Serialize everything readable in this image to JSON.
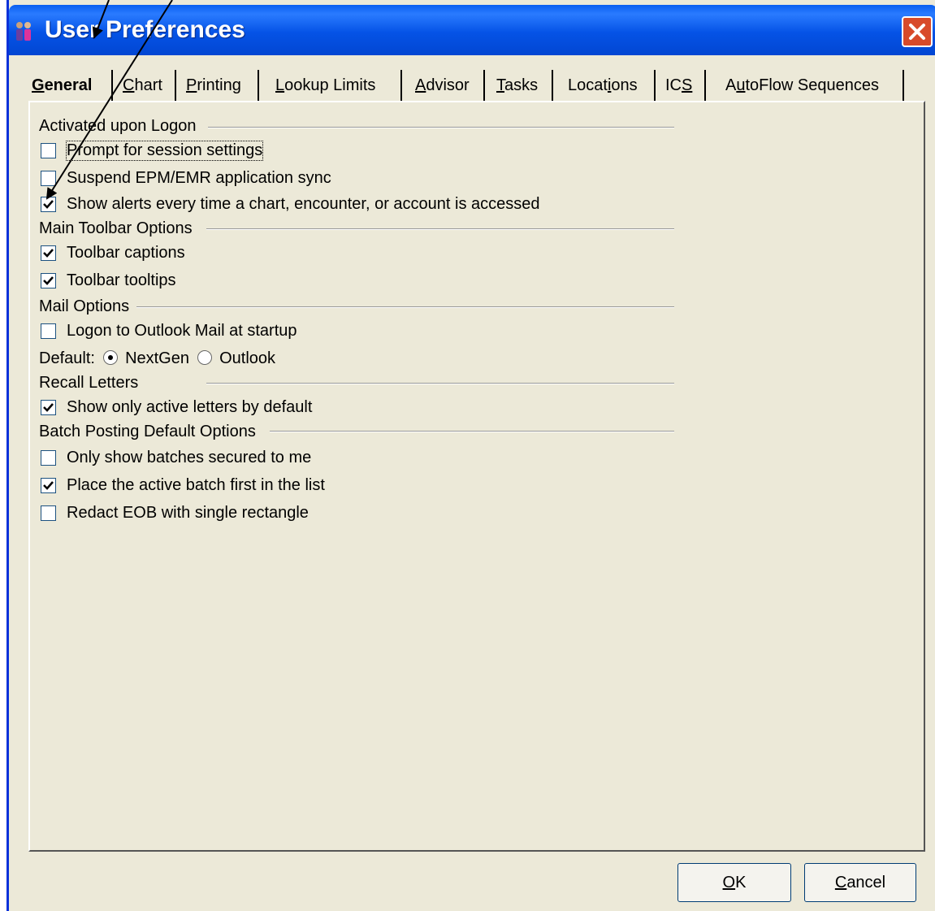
{
  "window": {
    "title": "User Preferences"
  },
  "tabs": [
    {
      "label": "General",
      "u": "G",
      "rest": "eneral",
      "pre": ""
    },
    {
      "label": "Chart",
      "pre": "",
      "u": "C",
      "rest": "hart"
    },
    {
      "label": "Printing",
      "pre": "",
      "u": "P",
      "rest": "rinting"
    },
    {
      "label": "Lookup Limits",
      "pre": "",
      "u": "L",
      "rest": "ookup Limits"
    },
    {
      "label": "Advisor",
      "pre": "",
      "u": "A",
      "rest": "dvisor"
    },
    {
      "label": "Tasks",
      "pre": "",
      "u": "T",
      "rest": "asks"
    },
    {
      "label": "Locations",
      "pre": "Locat",
      "u": "i",
      "rest": "ons"
    },
    {
      "label": "ICS",
      "pre": "IC",
      "u": "S",
      "rest": ""
    },
    {
      "label": "AutoFlow Sequences",
      "pre": "A",
      "u": "u",
      "rest": "toFlow Sequences"
    }
  ],
  "groups": {
    "logon": "Activated upon Logon",
    "toolbar": "Main Toolbar Options",
    "mail": "Mail Options",
    "recall": "Recall Letters",
    "batch": "Batch Posting Default Options"
  },
  "options": {
    "prompt_session": {
      "label": "Prompt for session settings",
      "checked": false
    },
    "suspend_sync": {
      "label": "Suspend EPM/EMR application sync",
      "checked": false
    },
    "show_alerts": {
      "label": "Show alerts every time a chart, encounter, or account is accessed",
      "checked": true
    },
    "toolbar_captions": {
      "label": "Toolbar captions",
      "checked": true
    },
    "toolbar_tooltips": {
      "label": "Toolbar tooltips",
      "checked": true
    },
    "logon_outlook": {
      "label": "Logon to Outlook Mail at startup",
      "checked": false
    },
    "active_letters": {
      "label": "Show only active letters by default",
      "checked": true
    },
    "batches_secured": {
      "label": "Only show batches secured to me",
      "checked": false
    },
    "active_batch_first": {
      "label": "Place the active batch first in the list",
      "checked": true
    },
    "redact_eob": {
      "label": "Redact EOB with single rectangle",
      "checked": false
    }
  },
  "mail_default": {
    "label": "Default:",
    "options": [
      "NextGen",
      "Outlook"
    ],
    "selected": "NextGen"
  },
  "buttons": {
    "ok": {
      "u": "O",
      "rest": "K"
    },
    "cancel": {
      "u": "C",
      "rest": "ancel"
    }
  }
}
